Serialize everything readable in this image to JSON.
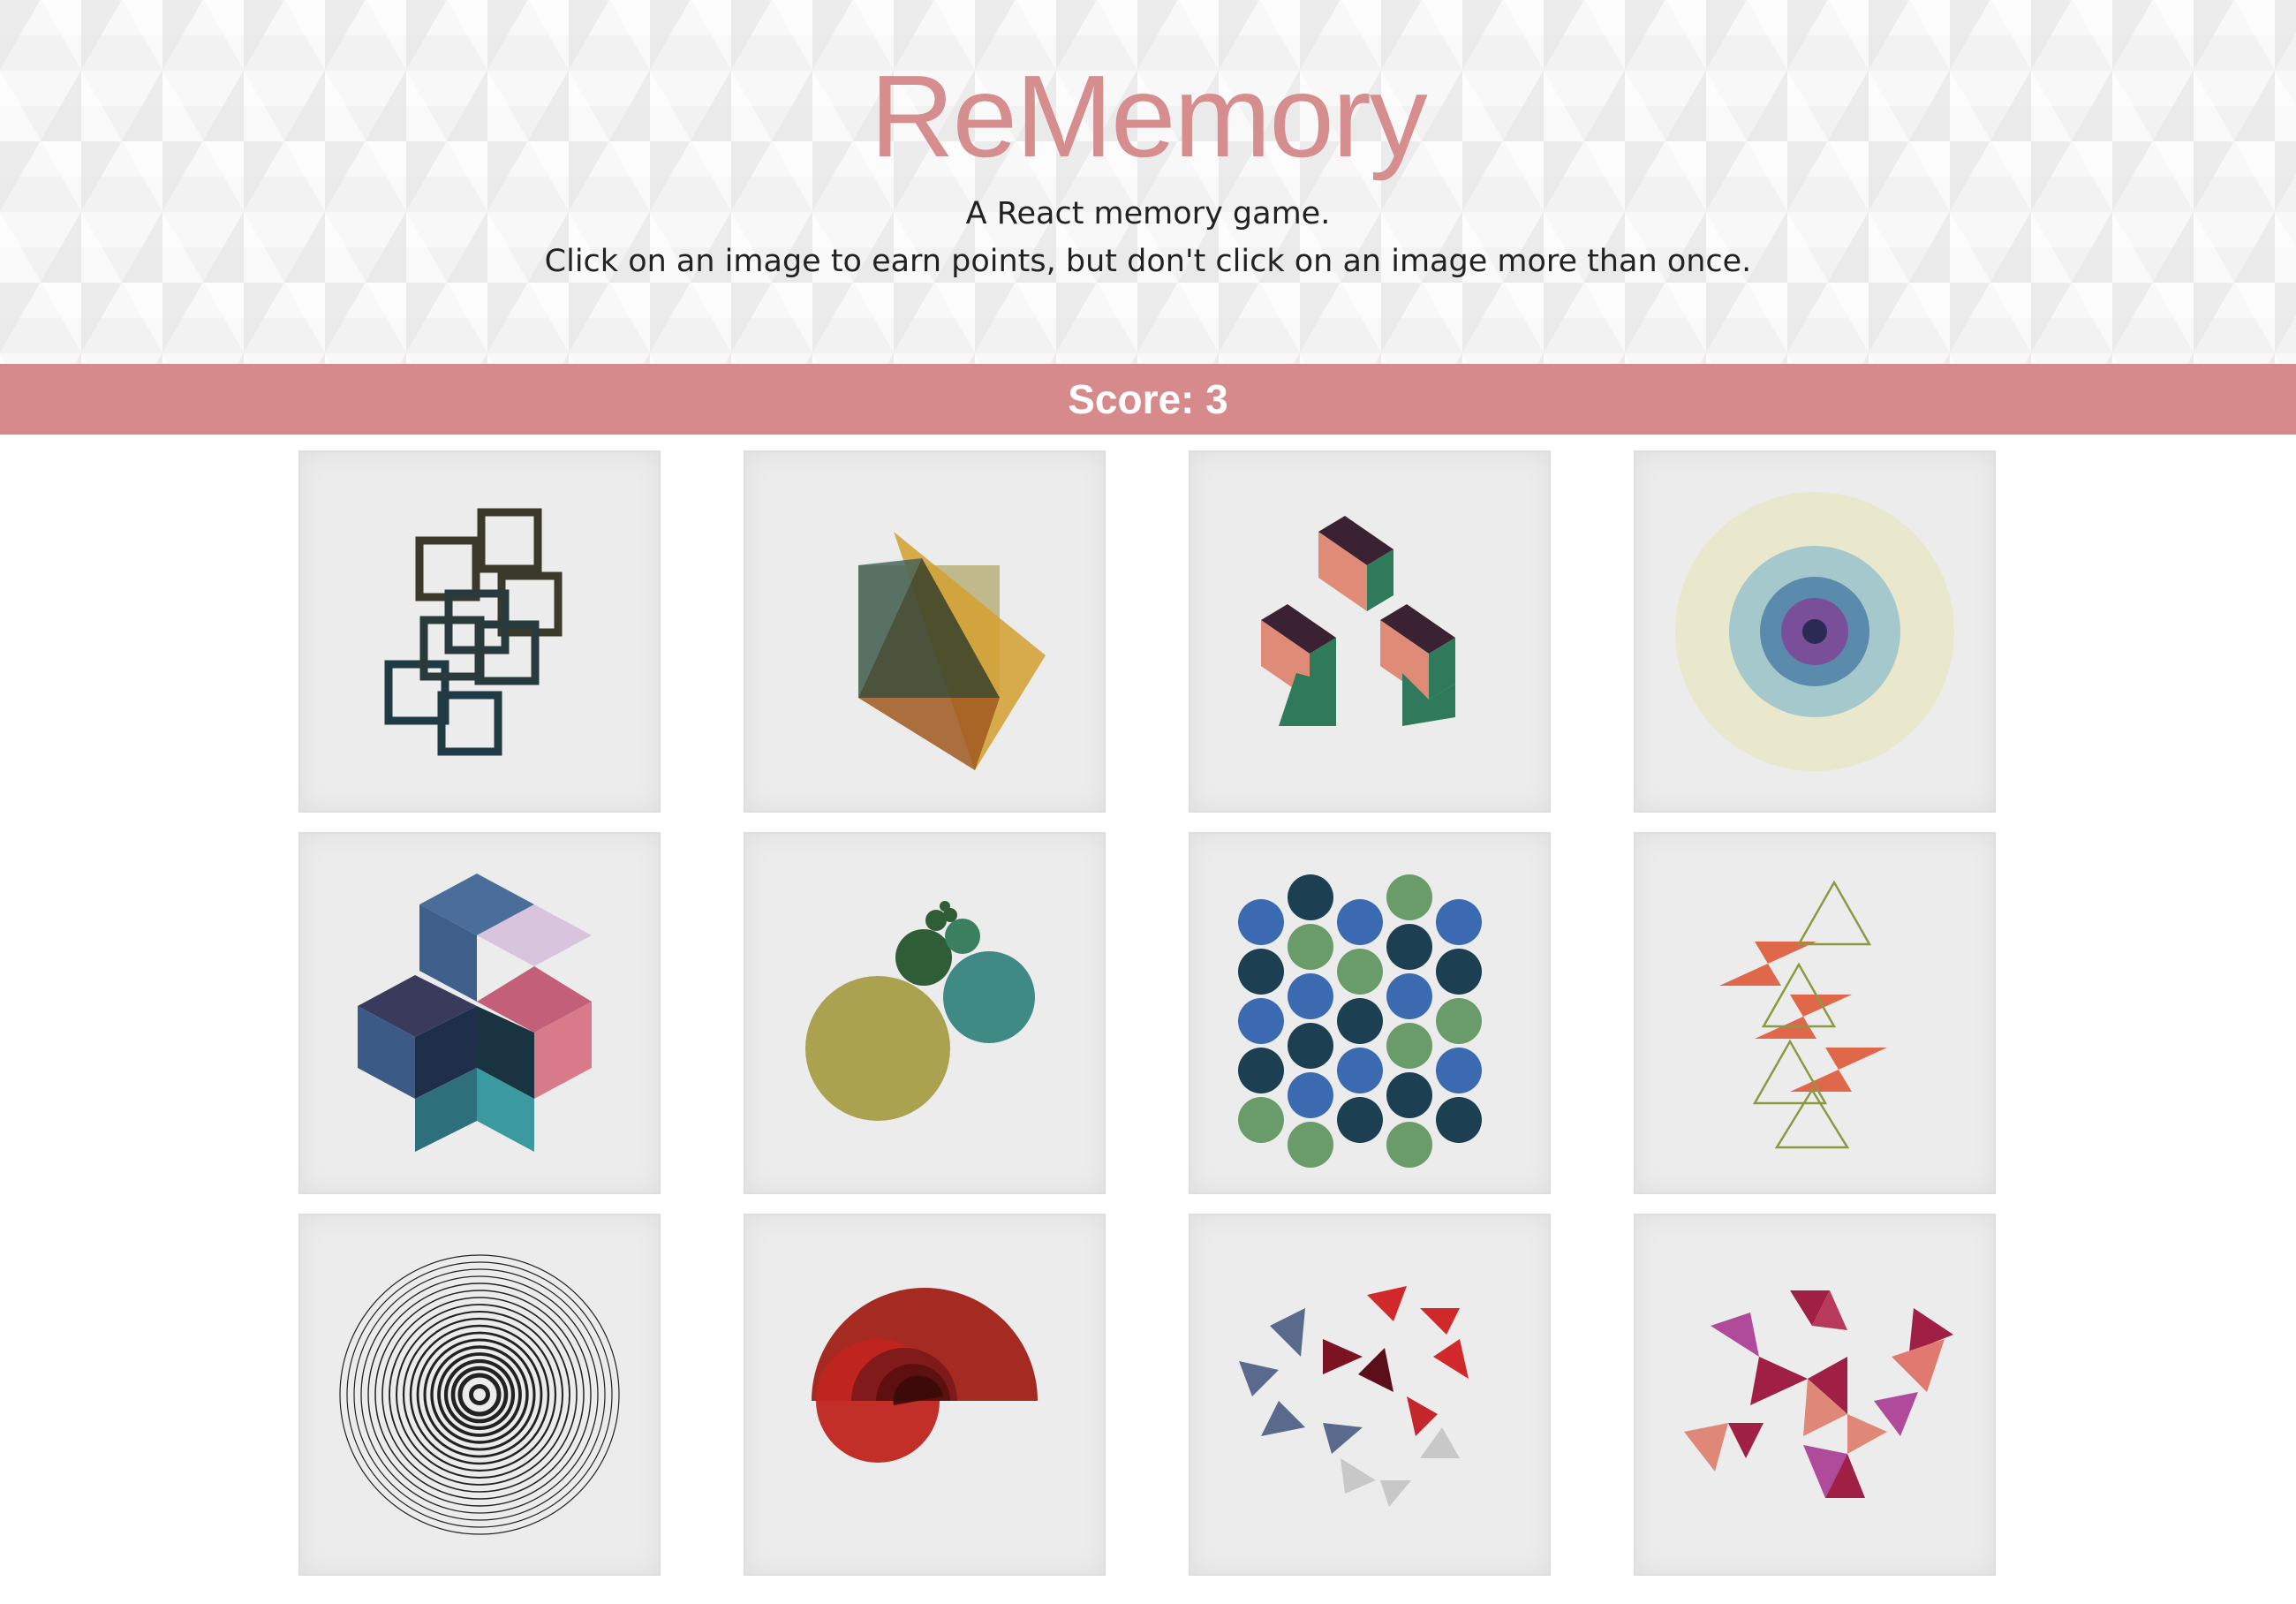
{
  "header": {
    "title": "ReMemory",
    "subtitle_line1": "A React memory game.",
    "subtitle_line2": "Click on an image to earn points, but don't click on an image more than once."
  },
  "scorebar": {
    "score_text": "Score: 3"
  },
  "colors": {
    "accent": "#d68a8b",
    "title": "#d68d8e",
    "card_bg": "#ececec"
  },
  "cards": [
    {
      "name": "interlocking-squares-image"
    },
    {
      "name": "triangle-square-image"
    },
    {
      "name": "isometric-blocks-image"
    },
    {
      "name": "concentric-circles-image"
    },
    {
      "name": "isometric-cubes-image"
    },
    {
      "name": "circles-cluster-image"
    },
    {
      "name": "circle-pattern-image"
    },
    {
      "name": "parallelograms-triangles-image"
    },
    {
      "name": "ripple-rings-image"
    },
    {
      "name": "red-semicircle-image"
    },
    {
      "name": "scattered-triangles-image"
    },
    {
      "name": "magenta-triangles-image"
    }
  ]
}
